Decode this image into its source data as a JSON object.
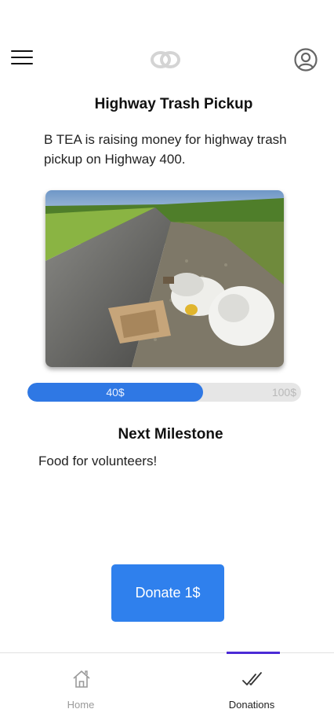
{
  "header": {
    "menu_icon": "hamburger-menu-icon",
    "logo_icon": "linked-rings-logo-icon",
    "account_icon": "user-circle-icon"
  },
  "campaign": {
    "title": "Highway Trash Pickup",
    "description": "B TEA is raising money for highway trash pickup on Highway 400.",
    "image": "roadside-trash-photo"
  },
  "progress": {
    "raised_label": "40$",
    "goal_label": "100$",
    "raised": 40,
    "goal": 100,
    "fill_color": "#2f78e4",
    "track_color": "#e6e6e6"
  },
  "milestone": {
    "heading": "Next Milestone",
    "text": "Food for volunteers!"
  },
  "donate": {
    "label": "Donate 1$",
    "color": "#2f80ed"
  },
  "bottom_nav": {
    "items": [
      {
        "label": "Home",
        "icon": "home-icon",
        "active": false
      },
      {
        "label": "Donations",
        "icon": "double-check-icon",
        "active": true
      }
    ],
    "active_indicator_color": "#4b2ad6"
  }
}
